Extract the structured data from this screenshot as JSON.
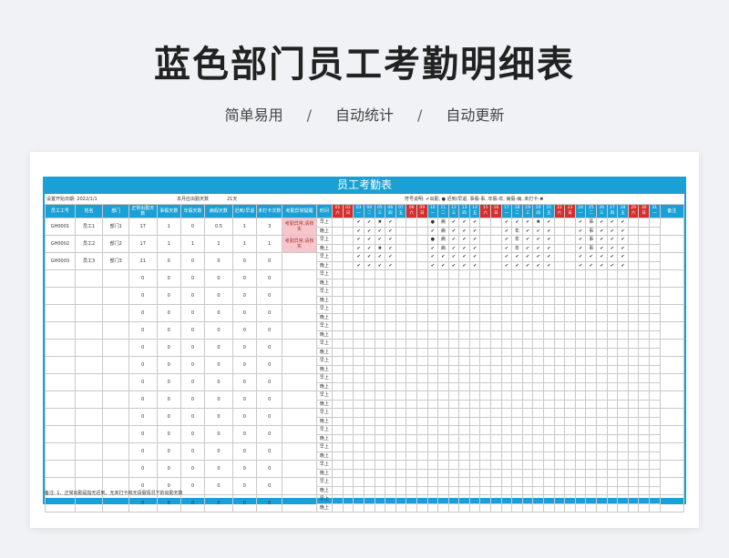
{
  "page": {
    "title": "蓝色部门员工考勤明细表",
    "subtitle_items": [
      "简单易用",
      "自动统计",
      "自动更新"
    ],
    "separator": "/"
  },
  "sheet": {
    "title": "员工考勤表",
    "info": {
      "start_date": "设置开始日期: 2022/1/1",
      "days_label": "本月应出勤天数",
      "days_value": "21天",
      "legend": "符号说明: ✔出勤, ● 迟到/早退, 事假-事, 年假-年, 病假-病, 未打卡-✖"
    },
    "headers": [
      "员工工号",
      "姓名",
      "部门",
      "正常出勤天数",
      "事假天数",
      "年假天数",
      "病假天数",
      "迟到/早退",
      "未打卡次数",
      "考勤异常提醒",
      "时间"
    ],
    "days": [
      {
        "d": "01",
        "w": "六",
        "red": true
      },
      {
        "d": "02",
        "w": "日",
        "red": true
      },
      {
        "d": "03",
        "w": "一",
        "red": false
      },
      {
        "d": "04",
        "w": "二",
        "red": false
      },
      {
        "d": "05",
        "w": "三",
        "red": false
      },
      {
        "d": "06",
        "w": "四",
        "red": false
      },
      {
        "d": "07",
        "w": "五",
        "red": false
      },
      {
        "d": "08",
        "w": "六",
        "red": true
      },
      {
        "d": "09",
        "w": "日",
        "red": true
      },
      {
        "d": "10",
        "w": "一",
        "red": false
      },
      {
        "d": "11",
        "w": "二",
        "red": false
      },
      {
        "d": "12",
        "w": "三",
        "red": false
      },
      {
        "d": "13",
        "w": "四",
        "red": false
      },
      {
        "d": "14",
        "w": "五",
        "red": false
      },
      {
        "d": "15",
        "w": "六",
        "red": true
      },
      {
        "d": "16",
        "w": "日",
        "red": true
      },
      {
        "d": "17",
        "w": "一",
        "red": false
      },
      {
        "d": "18",
        "w": "二",
        "red": false
      },
      {
        "d": "19",
        "w": "三",
        "red": false
      },
      {
        "d": "20",
        "w": "四",
        "red": false
      },
      {
        "d": "21",
        "w": "五",
        "red": false
      },
      {
        "d": "22",
        "w": "六",
        "red": true
      },
      {
        "d": "23",
        "w": "日",
        "red": true
      },
      {
        "d": "24",
        "w": "一",
        "red": false
      },
      {
        "d": "25",
        "w": "二",
        "red": false
      },
      {
        "d": "26",
        "w": "三",
        "red": false
      },
      {
        "d": "27",
        "w": "四",
        "red": false
      },
      {
        "d": "28",
        "w": "五",
        "red": false
      },
      {
        "d": "29",
        "w": "六",
        "red": true
      },
      {
        "d": "30",
        "w": "日",
        "red": true
      },
      {
        "d": "31",
        "w": "一",
        "red": false
      }
    ],
    "remark_header": "备注",
    "time_labels": [
      "早上",
      "晚上"
    ],
    "employees": [
      {
        "id": "GH0001",
        "name": "员工1",
        "dept": "部门1",
        "normal": "17",
        "personal": "1",
        "annual": "0",
        "sick": "0.5",
        "late": "1",
        "missing": "3",
        "alert": "考勤异常,请核实",
        "am": [
          "",
          "",
          "✔",
          "✔",
          "✖",
          "✔",
          "",
          "",
          "",
          "●",
          "病",
          "✔",
          "✔",
          "✔",
          "",
          "",
          "✔",
          "✔",
          "✔",
          "✖",
          "✔",
          "",
          "",
          "✔",
          "事",
          "✔",
          "✔",
          "✔",
          "",
          "",
          ""
        ],
        "pm": [
          "",
          "",
          "✔",
          "✔",
          "✔",
          "✔",
          "",
          "",
          "",
          "✔",
          "病",
          "✔",
          "✔",
          "✔",
          "",
          "",
          "✔",
          "年",
          "✔",
          "✔",
          "✔",
          "",
          "",
          "✔",
          "事",
          "✔",
          "✔",
          "✔",
          "",
          "",
          ""
        ]
      },
      {
        "id": "GH0002",
        "name": "员工2",
        "dept": "部门2",
        "normal": "17",
        "personal": "1",
        "annual": "1",
        "sick": "1",
        "late": "1",
        "missing": "1",
        "alert": "考勤异常,请核实",
        "am": [
          "",
          "",
          "✔",
          "✔",
          "✔",
          "✔",
          "",
          "",
          "",
          "●",
          "病",
          "✔",
          "✔",
          "✔",
          "",
          "",
          "✔",
          "年",
          "✔",
          "✔",
          "✔",
          "",
          "",
          "✔",
          "事",
          "✔",
          "✔",
          "✔",
          "",
          "",
          ""
        ],
        "pm": [
          "",
          "",
          "✔",
          "✔",
          "✖",
          "✔",
          "",
          "",
          "",
          "✔",
          "病",
          "✔",
          "✔",
          "✔",
          "",
          "",
          "✔",
          "年",
          "✔",
          "✔",
          "✔",
          "",
          "",
          "✔",
          "事",
          "✔",
          "✔",
          "✔",
          "",
          "",
          ""
        ]
      },
      {
        "id": "GH0003",
        "name": "员工3",
        "dept": "部门3",
        "normal": "21",
        "personal": "0",
        "annual": "0",
        "sick": "0",
        "late": "0",
        "missing": "0",
        "alert": "",
        "am": [
          "",
          "",
          "✔",
          "✔",
          "✔",
          "✔",
          "",
          "",
          "",
          "✔",
          "✔",
          "✔",
          "✔",
          "✔",
          "",
          "",
          "✔",
          "✔",
          "✔",
          "✔",
          "✔",
          "",
          "",
          "✔",
          "✔",
          "✔",
          "✔",
          "✔",
          "",
          "",
          ""
        ],
        "pm": [
          "",
          "",
          "✔",
          "✔",
          "✔",
          "✔",
          "",
          "",
          "",
          "✔",
          "✔",
          "✔",
          "✔",
          "✔",
          "",
          "",
          "✔",
          "✔",
          "✔",
          "✔",
          "✔",
          "",
          "",
          "✔",
          "✔",
          "✔",
          "✔",
          "✔",
          "",
          "",
          ""
        ]
      }
    ],
    "empty_row_value": "0",
    "note": "备注: 1、正常出勤是指无迟到、无未打卡和无请假情况下的出勤天数"
  }
}
